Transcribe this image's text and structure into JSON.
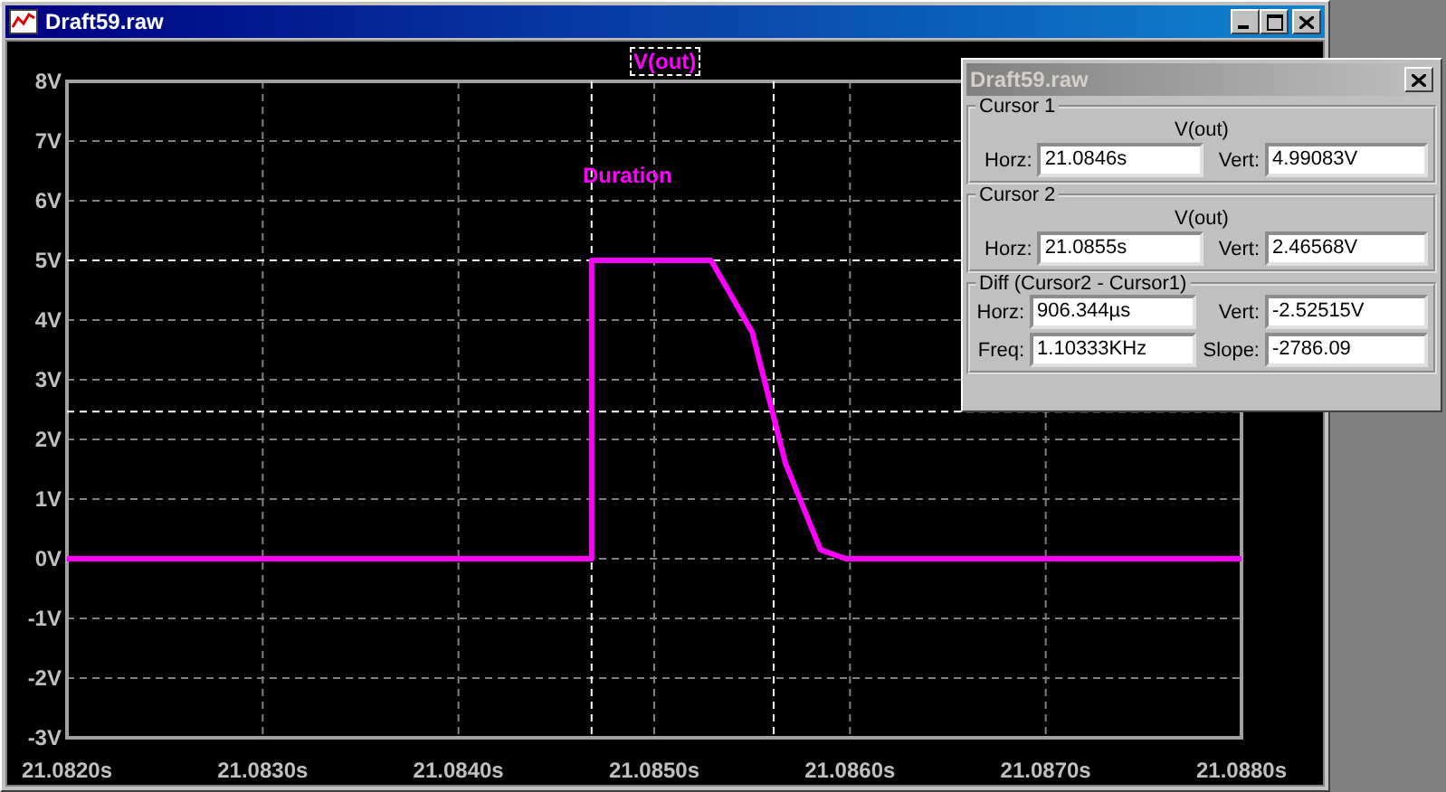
{
  "window": {
    "title": "Draft59.raw"
  },
  "plot": {
    "chart_data": {
      "type": "line",
      "grid": true,
      "xlim": [
        21.082,
        21.088
      ],
      "ylim": [
        -3,
        8
      ],
      "xticks": [
        {
          "value": 21.082,
          "label": "21.0820s"
        },
        {
          "value": 21.083,
          "label": "21.0830s"
        },
        {
          "value": 21.084,
          "label": "21.0840s"
        },
        {
          "value": 21.085,
          "label": "21.0850s"
        },
        {
          "value": 21.086,
          "label": "21.0860s"
        },
        {
          "value": 21.087,
          "label": "21.0870s"
        },
        {
          "value": 21.088,
          "label": "21.0880s"
        }
      ],
      "yticks": [
        {
          "value": 8,
          "label": "8V"
        },
        {
          "value": 7,
          "label": "7V"
        },
        {
          "value": 6,
          "label": "6V"
        },
        {
          "value": 5,
          "label": "5V"
        },
        {
          "value": 4,
          "label": "4V"
        },
        {
          "value": 3,
          "label": "3V"
        },
        {
          "value": 2,
          "label": "2V"
        },
        {
          "value": 1,
          "label": "1V"
        },
        {
          "value": 0,
          "label": "0V"
        },
        {
          "value": -1,
          "label": "-1V"
        },
        {
          "value": -2,
          "label": "-2V"
        },
        {
          "value": -3,
          "label": "-3V"
        }
      ],
      "x": [
        21.082,
        21.08468,
        21.08468,
        21.08529,
        21.0855,
        21.08567,
        21.08585,
        21.08598,
        21.088
      ],
      "series": [
        {
          "name": "V(out)",
          "color": "#ff00ff",
          "values": [
            0,
            0,
            5,
            5,
            3.8,
            1.6,
            0.15,
            0,
            0
          ]
        }
      ],
      "ref_lines": [
        {
          "axis": "x",
          "value": 21.08468
        },
        {
          "axis": "x",
          "value": 21.08561
        },
        {
          "axis": "y",
          "value": 5
        },
        {
          "axis": "y",
          "value": 2.465
        }
      ],
      "annotations": [
        "Duration"
      ]
    }
  },
  "cursor_dialog": {
    "title": "Draft59.raw",
    "groups": [
      {
        "title": "Cursor 1",
        "trace": "V(out)",
        "fields": [
          {
            "label": "Horz:",
            "value": "21.0846s"
          },
          {
            "label": "Vert:",
            "value": "4.99083V"
          }
        ]
      },
      {
        "title": "Cursor 2",
        "trace": "V(out)",
        "fields": [
          {
            "label": "Horz:",
            "value": "21.0855s"
          },
          {
            "label": "Vert:",
            "value": "2.46568V"
          }
        ]
      },
      {
        "title": "Diff (Cursor2 - Cursor1)",
        "fields": [
          {
            "label": "Horz:",
            "value": "906.344µs"
          },
          {
            "label": "Vert:",
            "value": "-2.52515V"
          },
          {
            "label": "Freq:",
            "value": "1.10333KHz"
          },
          {
            "label": "Slope:",
            "value": "-2786.09"
          }
        ]
      }
    ]
  }
}
